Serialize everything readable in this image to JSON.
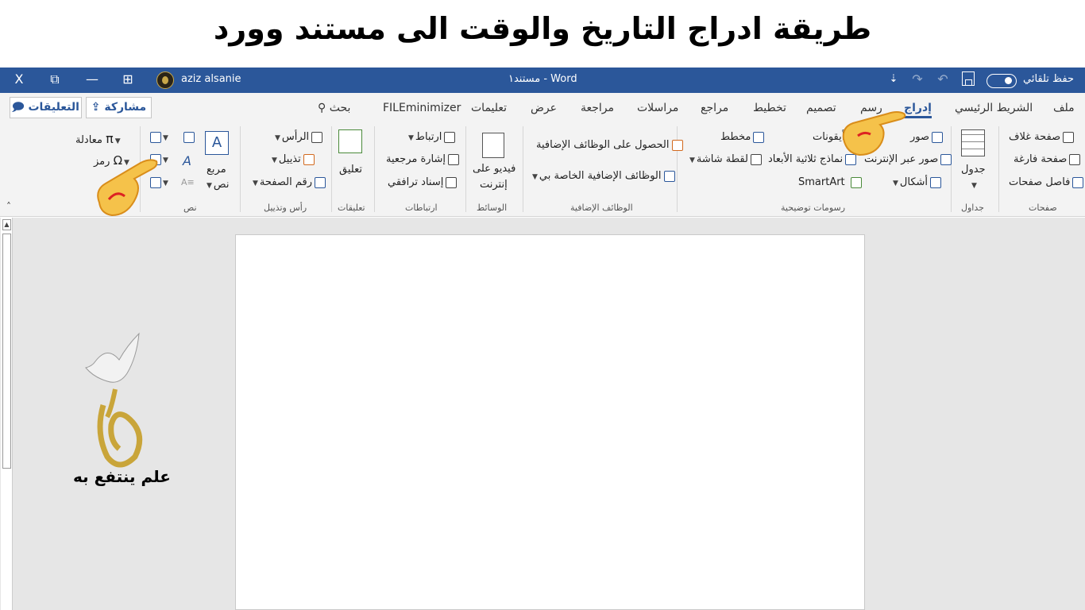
{
  "banner": {
    "title": "طريقة ادراج التاريخ والوقت الى مستند وورد"
  },
  "titlebar": {
    "user_name": "aziz alsanie",
    "doc_title": "مستند١  -  Word",
    "autosave_label": "حفظ تلقائي",
    "close_glyph": "X",
    "restore_glyph": "⧉",
    "minimize_glyph": "—",
    "ribbon_display_glyph": "⊞",
    "customize_glyph": "⇣",
    "undo_glyph": "↶",
    "redo_glyph": "↷"
  },
  "tabs": {
    "file": "ملف",
    "home": "الشريط الرئيسي",
    "insert": "إدراج",
    "draw": "رسم",
    "design": "تصميم",
    "layout": "تخطيط",
    "references": "مراجع",
    "mailings": "مراسلات",
    "review": "مراجعة",
    "view": "عرض",
    "help": "تعليمات",
    "fileminimizer": "FILEminimizer",
    "search": "بحث",
    "share": "مشاركة",
    "comments": "التعليقات"
  },
  "ribbon": {
    "pages": {
      "label": "صفحات",
      "cover": "صفحة غلاف",
      "blank": "صفحة فارغة",
      "break": "فاصل صفحات"
    },
    "tables": {
      "label": "جداول",
      "table": "جدول"
    },
    "illustrations": {
      "label": "رسومات توضيحية",
      "pictures": "صور",
      "online_pictures": "صور عبر الإنترنت",
      "shapes": "أشكال",
      "icons": "أيقونات",
      "models_3d": "نماذج ثلاثية الأبعاد",
      "smartart": "SmartArt",
      "chart": "مخطط",
      "screenshot": "لقطة شاشة"
    },
    "addins": {
      "label": "الوظائف الإضافية",
      "get": "الحصول على الوظائف الإضافية",
      "my": "الوظائف الإضافية الخاصة بي"
    },
    "media": {
      "label": "الوسائط",
      "online_video_1": "فيديو على",
      "online_video_2": "إنترنت"
    },
    "links": {
      "label": "ارتباطات",
      "link": "ارتباط",
      "bookmark": "إشارة مرجعية",
      "cross_ref": "إسناد ترافقي"
    },
    "comments": {
      "label": "تعليقات",
      "comment": "تعليق"
    },
    "header_footer": {
      "label": "رأس وتذييل",
      "header": "الرأس",
      "footer": "تذييل",
      "page_number": "رقم الصفحة"
    },
    "text": {
      "label": "نص",
      "textbox_1": "مربع",
      "textbox_2": "نص"
    },
    "symbols": {
      "equation": "معادلة",
      "symbol": "رمز"
    }
  },
  "logo": {
    "caption": "علم ينتفع به"
  },
  "colors": {
    "word_blue": "#2b579a",
    "ribbon_bg": "#f3f3f3",
    "work_bg": "#e6e6e6"
  }
}
